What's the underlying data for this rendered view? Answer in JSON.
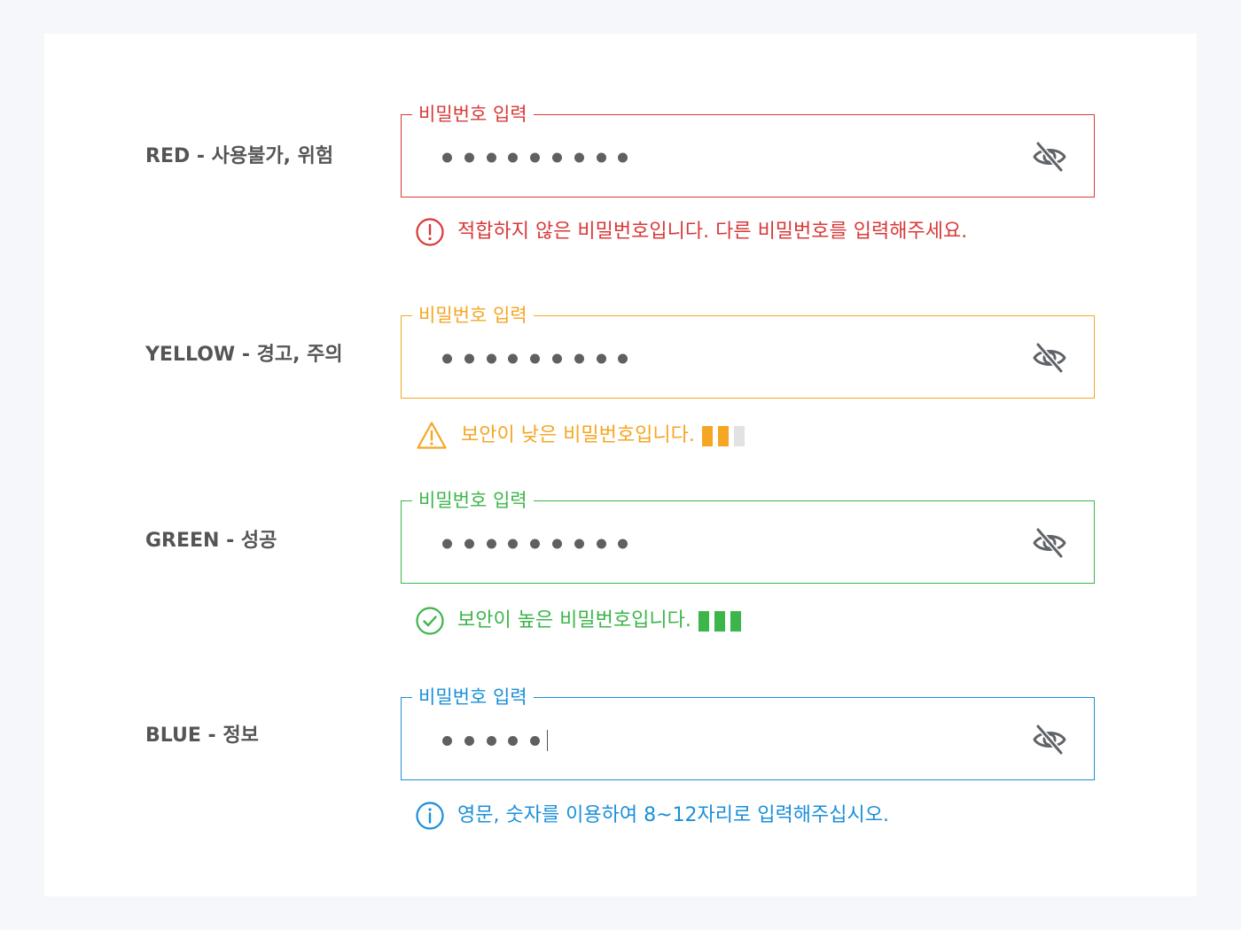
{
  "colors": {
    "red": "#d93838",
    "yellow": "#f5a623",
    "green": "#3cb54a",
    "blue": "#1a8fd8",
    "bar_empty": "#e2e2e2"
  },
  "icons": {
    "toggle": "eye-off-icon",
    "red": "error-circle-icon",
    "yellow": "warning-triangle-icon",
    "green": "check-circle-icon",
    "blue": "info-circle-icon"
  },
  "states": {
    "red": {
      "label": "RED - 사용불가, 위험",
      "field_label": "비밀번호 입력",
      "masked_length": 9,
      "message": "적합하지 않은 비밀번호입니다. 다른 비밀번호를 입력해주세요."
    },
    "yellow": {
      "label": "YELLOW - 경고, 주의",
      "field_label": "비밀번호 입력",
      "masked_length": 9,
      "message": "보안이 낮은 비밀번호입니다.",
      "strength": 2,
      "strength_max": 3
    },
    "green": {
      "label": "GREEN - 성공",
      "field_label": "비밀번호 입력",
      "masked_length": 9,
      "message": "보안이 높은 비밀번호입니다.",
      "strength": 3,
      "strength_max": 3
    },
    "blue": {
      "label": "BLUE - 정보",
      "field_label": "비밀번호 입력",
      "masked_length": 5,
      "message": "영문, 숫자를 이용하여 8~12자리로 입력해주십시오."
    }
  }
}
